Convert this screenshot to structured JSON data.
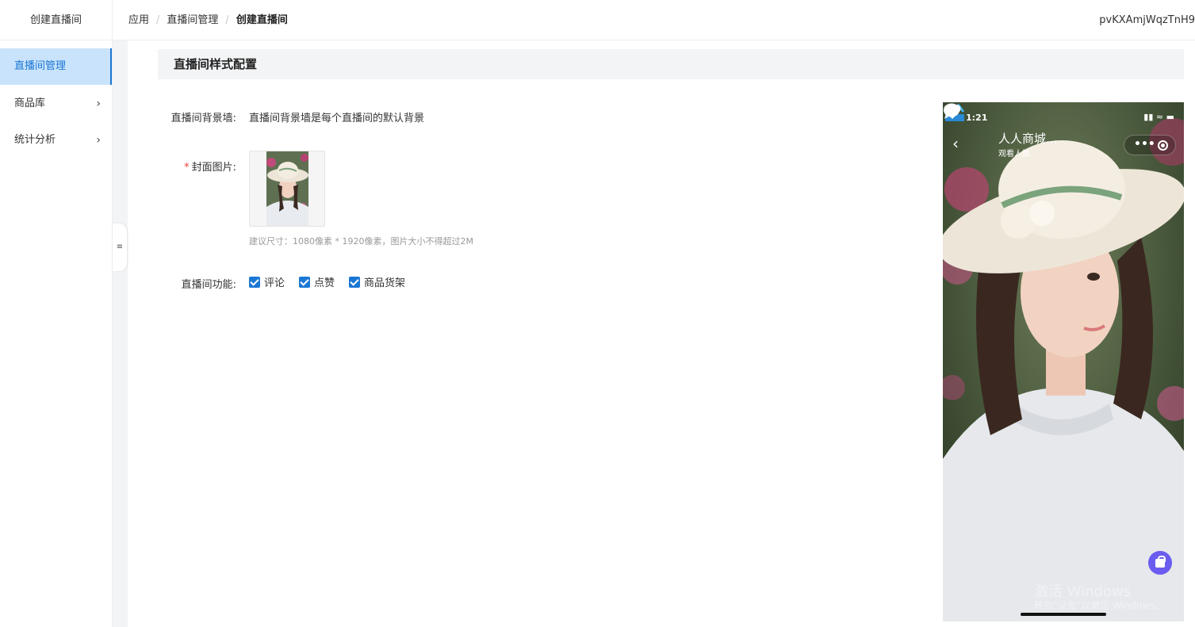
{
  "sidebar": {
    "title": "创建直播间",
    "items": [
      {
        "label": "直播间管理",
        "active": true
      },
      {
        "label": "商品库",
        "chevron": "chevron-right-icon"
      },
      {
        "label": "统计分析",
        "chevron": "chevron-right-icon"
      }
    ],
    "collapse_icon": "menu-fold-icon"
  },
  "header": {
    "breadcrumb": [
      "应用",
      "直播间管理",
      "创建直播间"
    ],
    "user": "pvKXAmjWqzTnH9"
  },
  "section": {
    "title": "直播间样式配置"
  },
  "form": {
    "background_label": "直播间背景墙:",
    "background_value": "直播间背景墙是每个直播间的默认背景",
    "cover_required": "*",
    "cover_label": "封面图片:",
    "cover_hint": "建议尺寸：1080像素 * 1920像素，图片大小不得超过2M",
    "features_label": "直播间功能:",
    "features": [
      {
        "label": "评论",
        "checked": true
      },
      {
        "label": "点赞",
        "checked": true
      },
      {
        "label": "商品货架",
        "checked": true
      }
    ]
  },
  "preview": {
    "time": "1:21",
    "room_name": "人人商城...",
    "viewers_label": "观看人数",
    "capsule_dots": "•••"
  },
  "watermark": {
    "line1": "激活 Windows",
    "line2": "转到\"设置\"以激活 Windows。"
  },
  "colors": {
    "accent": "#1b77d4",
    "active_bg": "#c8e3fb",
    "required": "#f0413c",
    "bag_button": "#6b5cf0"
  }
}
